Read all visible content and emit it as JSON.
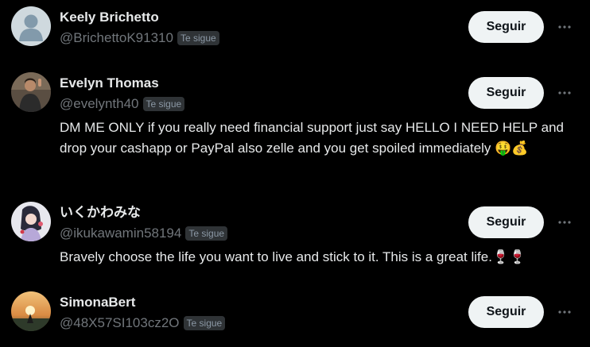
{
  "follow_label": "Seguir",
  "follows_you_label": "Te sigue",
  "users": [
    {
      "name": "Keely Brichetto",
      "handle": "@BrichettoK91310",
      "bio": ""
    },
    {
      "name": "Evelyn Thomas",
      "handle": "@evelynth40",
      "bio": "DM ME ONLY if you really need financial support just say HELLO I NEED HELP and drop your cashapp or PayPal also zelle and you get spoiled immediately 🤑💰"
    },
    {
      "name": "いくかわみな",
      "handle": "@ikukawamin58194",
      "bio": "Bravely choose the life you want to live and stick to it. This is a great life.🍷🍷"
    },
    {
      "name": "SimonaBert",
      "handle": "@48X57SI103cz2O",
      "bio": ""
    }
  ],
  "colors": {
    "background": "#000000",
    "primary_text": "#e7e9ea",
    "secondary_text": "#71767b",
    "badge_bg": "#2f3336",
    "button_bg": "#eff3f4",
    "button_text": "#0f1419"
  },
  "icons": {
    "more": "more-horizontal-icon",
    "default_avatar": "default-avatar-icon"
  }
}
